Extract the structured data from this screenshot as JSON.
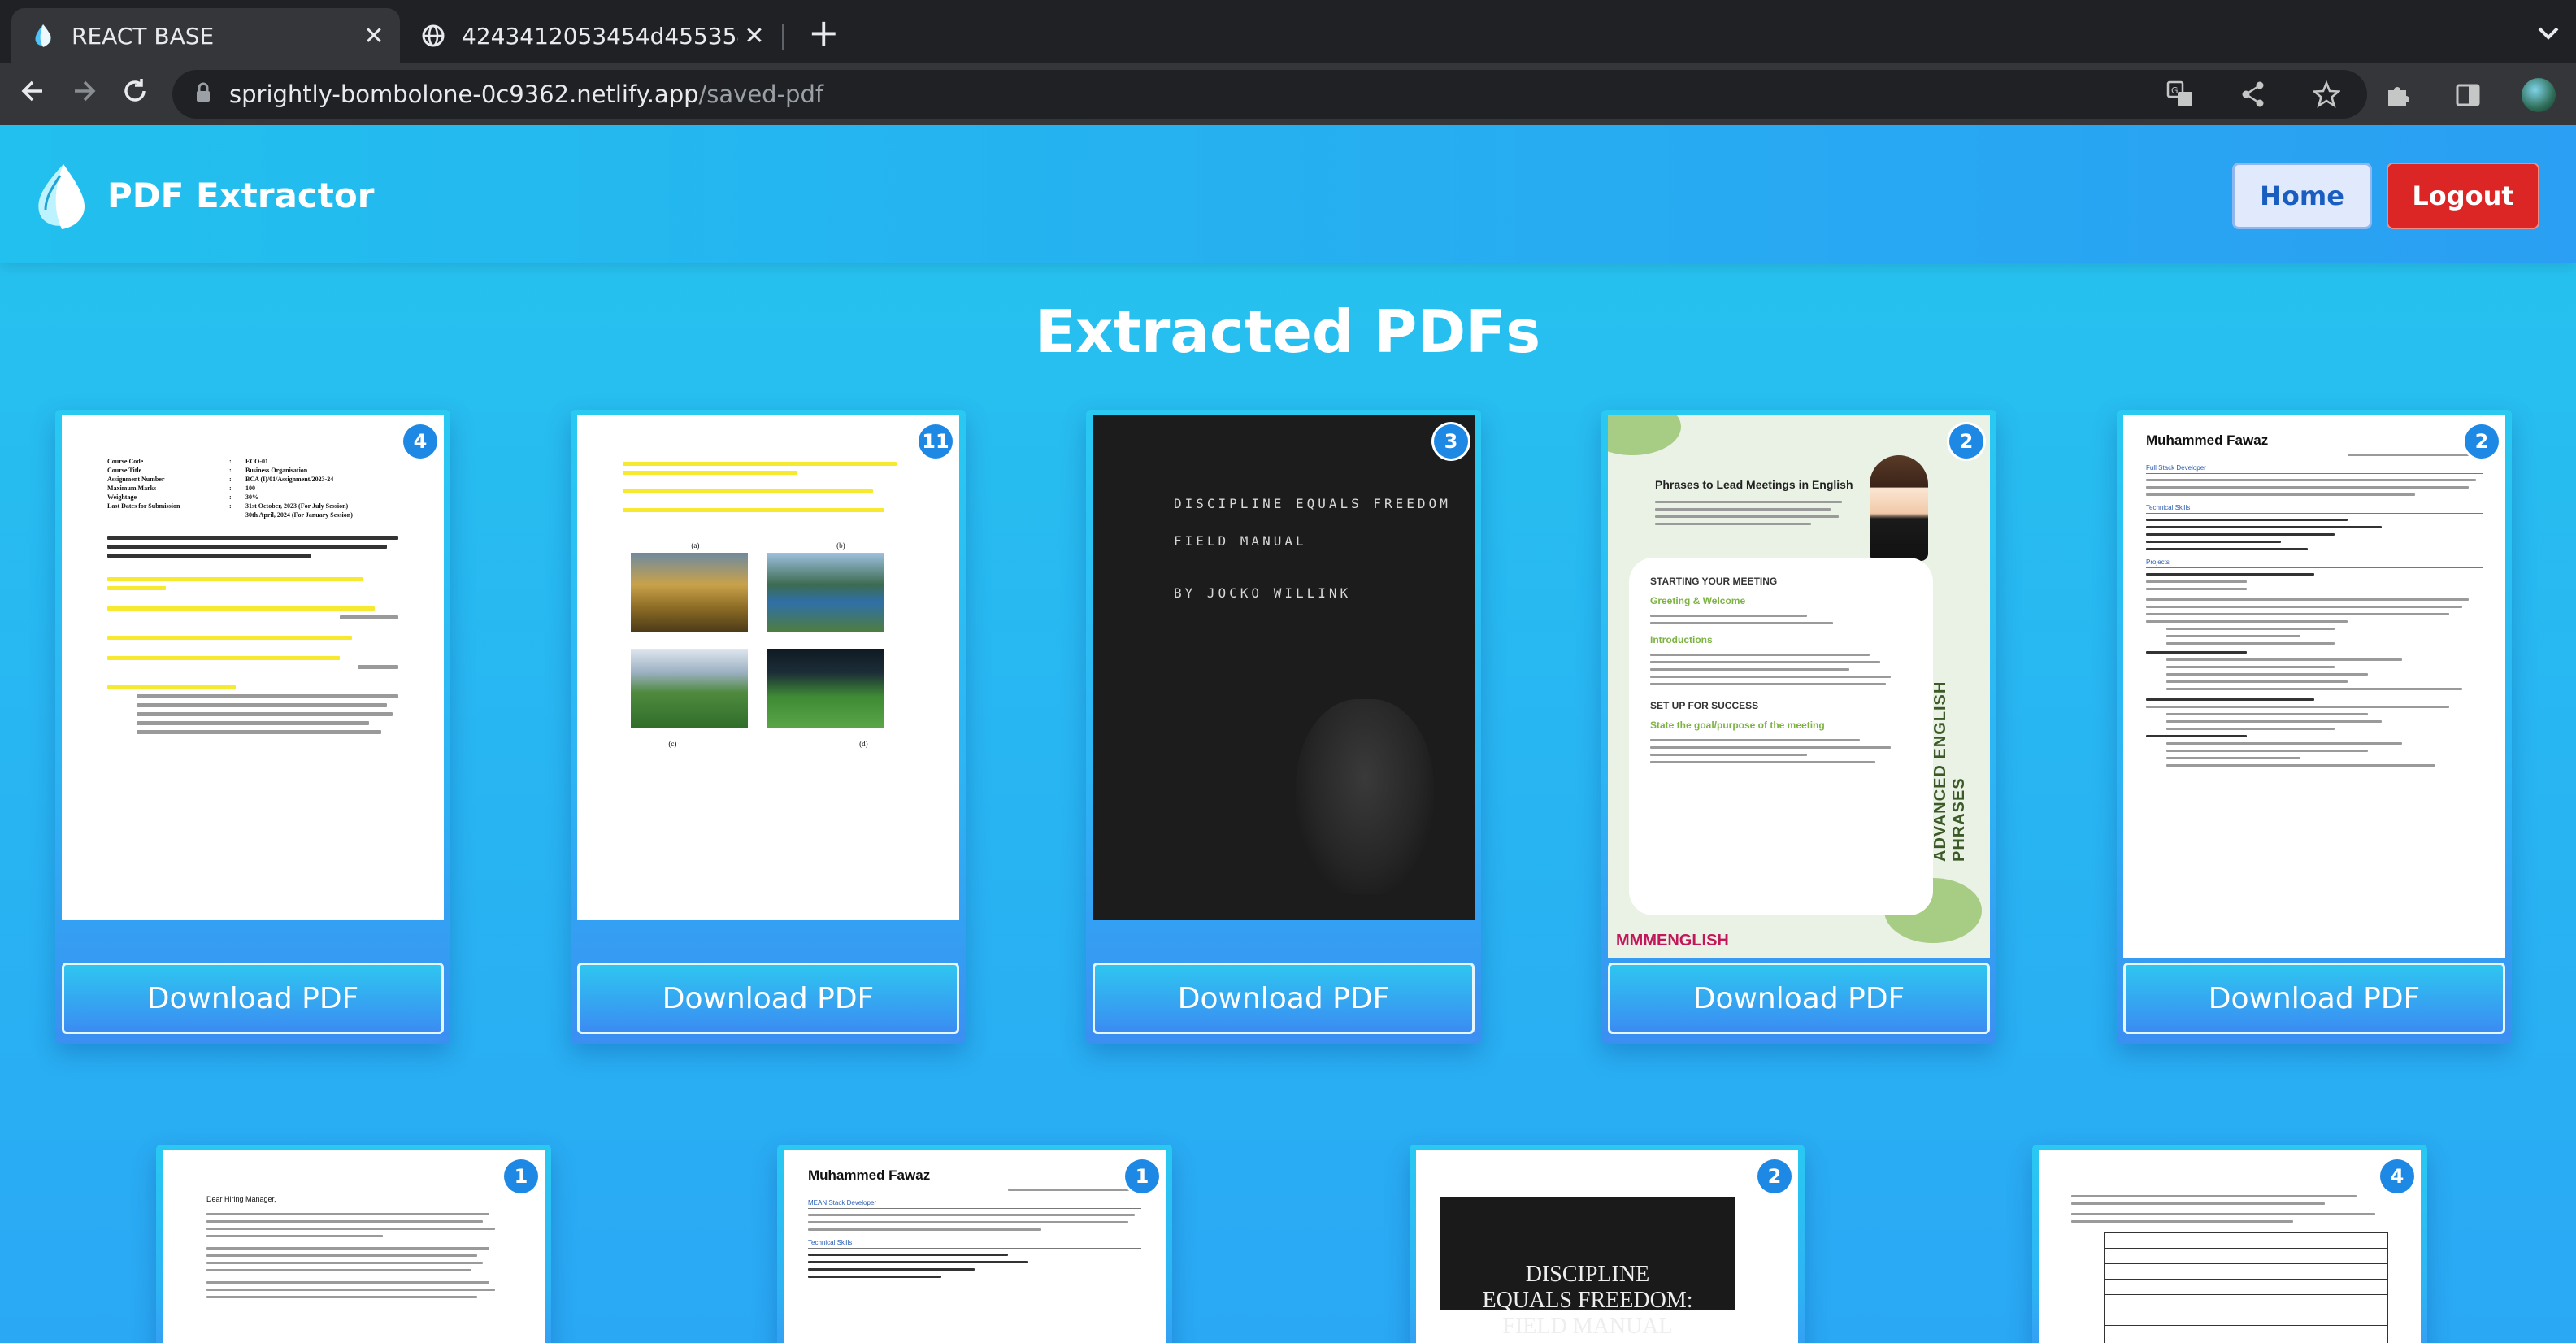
{
  "browser": {
    "tabs": [
      {
        "title": "REACT BASE",
        "active": true
      },
      {
        "title": "4243412053454d455354",
        "active": false
      }
    ],
    "new_tab": "+",
    "tab_close": "✕",
    "url_host": "sprightly-bombolone-0c9362.netlify.app",
    "url_path": "/saved-pdf",
    "icons": [
      "back-icon",
      "forward-icon",
      "reload-icon",
      "lock-icon",
      "translate-icon",
      "share-icon",
      "bookmark-star-icon",
      "extensions-icon",
      "side-panel-icon",
      "profile-avatar",
      "menu-icon"
    ]
  },
  "header": {
    "brand": "PDF Extractor",
    "home_label": "Home",
    "logout_label": "Logout"
  },
  "page": {
    "title": "Extracted PDFs",
    "download_label": "Download PDF"
  },
  "cards_row1": [
    {
      "pages": "4",
      "kind": "assignment",
      "lines": [
        "Course Code",
        "ECO-01",
        "Course Title",
        "Business Organisation",
        "Assignment Number",
        "BCA (I)/01/Assignment/2023-24",
        "Maximum Marks",
        "100",
        "Weightage",
        "30%",
        "Last Dates for Submission",
        "31st October, 2023 (For July Session)",
        "30th April, 2024 (For January Session)"
      ]
    },
    {
      "pages": "11",
      "kind": "question-paper",
      "labels": [
        "(a)",
        "(b)",
        "(c)",
        "(d)"
      ]
    },
    {
      "pages": "3",
      "kind": "book-cover",
      "lines": [
        "DISCIPLINE EQUALS FREEDOM",
        "FIELD MANUAL",
        "BY JOCKO WILLINK"
      ]
    },
    {
      "pages": "2",
      "kind": "english-guide",
      "lines": [
        "Phrases to Lead Meetings in English",
        "STARTING YOUR MEETING",
        "Greeting & Welcome",
        "Introductions",
        "SET UP FOR SUCCESS",
        "State the goal/purpose of the meeting",
        "ADVANCED ENGLISH PHRASES",
        "MMMENGLISH"
      ]
    },
    {
      "pages": "2",
      "kind": "resume",
      "lines": [
        "Muhammed Fawaz",
        "Full Stack Developer",
        "Technical Skills",
        "Projects"
      ]
    }
  ],
  "cards_row2": [
    {
      "pages": "1",
      "kind": "letter",
      "lines": [
        "Dear Hiring Manager,"
      ]
    },
    {
      "pages": "1",
      "kind": "resume",
      "lines": [
        "Muhammed Fawaz",
        "MEAN Stack Developer",
        "Technical Skills"
      ]
    },
    {
      "pages": "2",
      "kind": "book-cover",
      "lines": [
        "DISCIPLINE",
        "EQUALS FREEDOM:",
        "FIELD MANUAL"
      ]
    },
    {
      "pages": "4",
      "kind": "worksheet",
      "lines": []
    }
  ],
  "colors": {
    "accent": "#29b6f6",
    "logout": "#dc2626",
    "badge": "#1e88e5"
  }
}
